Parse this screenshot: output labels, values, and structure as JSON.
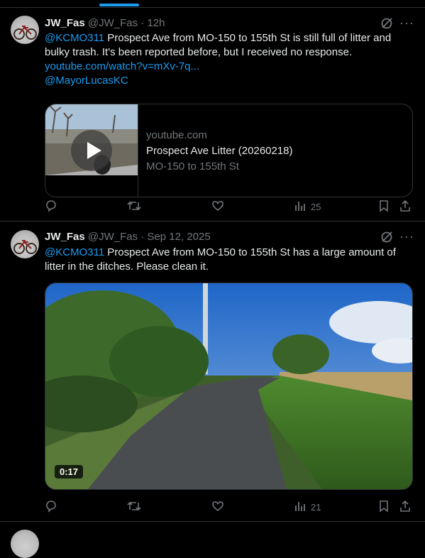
{
  "tweets": [
    {
      "name": "JW_Fas",
      "handle": "@JW_Fas",
      "time": "· 12h",
      "mention": "@KCMO311",
      "text": " Prospect Ave from MO-150 to 155th St is still full of litter and bulky trash. It's been reported before, but I received no response.",
      "link": "youtube.com/watch?v=mXv-7q...",
      "tag": "@MayorLucasKC",
      "card": {
        "domain": "youtube.com",
        "title": "Prospect Ave Litter (20260218)",
        "desc": "MO-150 to 155th St"
      },
      "views": "25"
    },
    {
      "name": "JW_Fas",
      "handle": "@JW_Fas",
      "time": "· Sep 12, 2025",
      "mention": "@KCMO311",
      "text": " Prospect Ave from MO-150 to 155th St has a large amount of litter in the ditches. Please clean it.",
      "duration": "0:17",
      "views": "21"
    }
  ],
  "more_label": "···"
}
